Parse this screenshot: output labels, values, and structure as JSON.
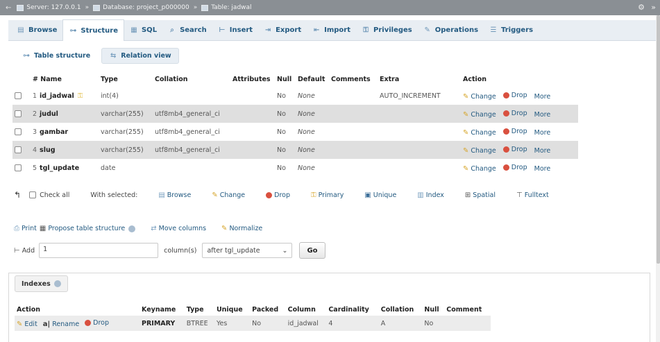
{
  "breadcrumb": {
    "server": "Server: 127.0.0.1",
    "database": "Database: project_p000000",
    "table": "Table: jadwal"
  },
  "tabs": [
    {
      "label": "Browse",
      "icon": "browse-icon"
    },
    {
      "label": "Structure",
      "icon": "structure-icon"
    },
    {
      "label": "SQL",
      "icon": "sql-icon"
    },
    {
      "label": "Search",
      "icon": "search-icon"
    },
    {
      "label": "Insert",
      "icon": "insert-icon"
    },
    {
      "label": "Export",
      "icon": "export-icon"
    },
    {
      "label": "Import",
      "icon": "import-icon"
    },
    {
      "label": "Privileges",
      "icon": "privileges-icon"
    },
    {
      "label": "Operations",
      "icon": "operations-icon"
    },
    {
      "label": "Triggers",
      "icon": "triggers-icon"
    }
  ],
  "subtabs": {
    "table_structure": "Table structure",
    "relation_view": "Relation view"
  },
  "structure": {
    "headers": {
      "num": "#",
      "name": "Name",
      "type": "Type",
      "collation": "Collation",
      "attributes": "Attributes",
      "null": "Null",
      "default": "Default",
      "comments": "Comments",
      "extra": "Extra",
      "action": "Action"
    },
    "rows": [
      {
        "num": "1",
        "name": "id_jadwal",
        "type": "int(4)",
        "collation": "",
        "null": "No",
        "default": "None",
        "extra": "AUTO_INCREMENT",
        "primary": true
      },
      {
        "num": "2",
        "name": "judul",
        "type": "varchar(255)",
        "collation": "utf8mb4_general_ci",
        "null": "No",
        "default": "None",
        "extra": "",
        "primary": false
      },
      {
        "num": "3",
        "name": "gambar",
        "type": "varchar(255)",
        "collation": "utf8mb4_general_ci",
        "null": "No",
        "default": "None",
        "extra": "",
        "primary": false
      },
      {
        "num": "4",
        "name": "slug",
        "type": "varchar(255)",
        "collation": "utf8mb4_general_ci",
        "null": "No",
        "default": "None",
        "extra": "",
        "primary": false
      },
      {
        "num": "5",
        "name": "tgl_update",
        "type": "date",
        "collation": "",
        "null": "No",
        "default": "None",
        "extra": "",
        "primary": false
      }
    ],
    "row_actions": {
      "change": "Change",
      "drop": "Drop",
      "more": "More"
    }
  },
  "with_selected": {
    "check_all": "Check all",
    "label": "With selected:",
    "actions": [
      "Browse",
      "Change",
      "Drop",
      "Primary",
      "Unique",
      "Index",
      "Spatial",
      "Fulltext"
    ]
  },
  "links": {
    "print": "Print",
    "propose": "Propose table structure",
    "move_columns": "Move columns",
    "normalize": "Normalize"
  },
  "add_column": {
    "label": "Add",
    "count": "1",
    "unit": "column(s)",
    "position": "after tgl_update",
    "go": "Go"
  },
  "indexes": {
    "legend": "Indexes",
    "headers": [
      "Action",
      "Keyname",
      "Type",
      "Unique",
      "Packed",
      "Column",
      "Cardinality",
      "Collation",
      "Null",
      "Comment"
    ],
    "row": {
      "edit": "Edit",
      "rename": "Rename",
      "drop": "Drop",
      "keyname": "PRIMARY",
      "type": "BTREE",
      "unique": "Yes",
      "packed": "No",
      "column": "id_jadwal",
      "cardinality": "4",
      "collation": "A",
      "null": "No",
      "comment": ""
    }
  }
}
